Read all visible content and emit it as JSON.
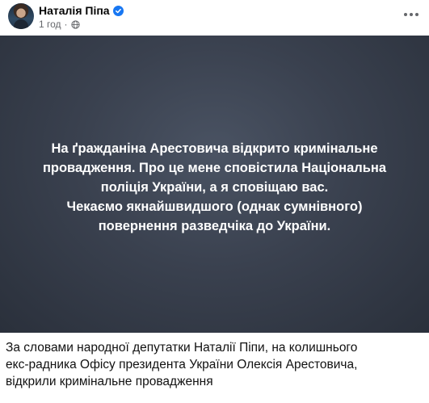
{
  "post": {
    "author_name": "Наталія Піпа",
    "time": "1 год",
    "separator": "·",
    "audience_icon": "globe-icon",
    "verified_icon": "verified-badge-icon",
    "more_icon": "more-options-icon",
    "text_lines": [
      "На ґражданіна Арестовича відкрито кримінальне",
      "провадження. Про це мене сповістила Національна",
      "поліція України, а я сповіщаю вас.",
      "Чекаємо якнайшвидшого (однак сумнівного)",
      "повернення разведчіка до України."
    ]
  },
  "caption": {
    "lines": [
      "За словами народної депутатки Наталії Піпи, на колишнього",
      "екс-радника Офісу президента України Олексія Арестовича,",
      "відкрили кримінальне провадження"
    ]
  },
  "colors": {
    "verified": "#1877f2",
    "card_background": "#3a414f",
    "card_text": "#ffffff"
  }
}
